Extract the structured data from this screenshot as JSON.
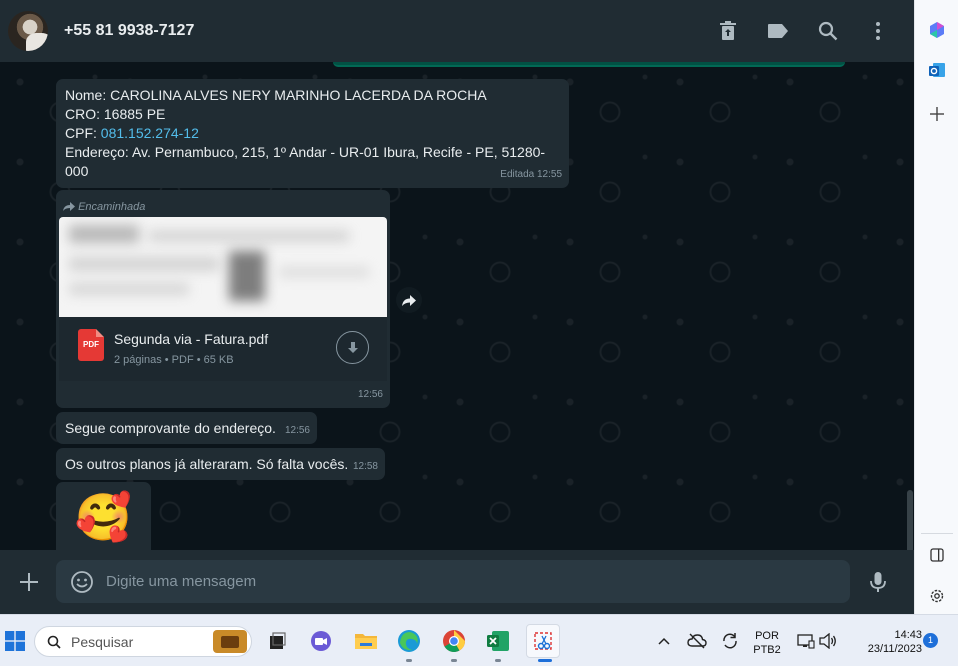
{
  "header": {
    "contact_name": "+55 81 9938-7127"
  },
  "messages": {
    "info": {
      "line1": "Nome: CAROLINA ALVES NERY MARINHO LACERDA DA ROCHA",
      "line2": "CRO: 16885 PE",
      "cpf_label": "CPF: ",
      "cpf_value": "081.152.274-12",
      "line4": "Endereço: Av. Pernambuco, 215, 1º Andar - UR-01 Ibura, Recife - PE, 51280-000",
      "time": "Editada 12:55"
    },
    "forwarded": {
      "label": "Encaminhada",
      "file_name": "Segunda via - Fatura.pdf",
      "file_meta": "2 páginas • PDF • 65 KB",
      "pdf_badge": "PDF",
      "time": "12:56"
    },
    "msg3": {
      "text": "Segue comprovante do endereço.",
      "time": "12:56"
    },
    "msg4": {
      "text": "Os outros planos já alteraram. Só falta vocês.",
      "time": "12:58"
    },
    "msg5": {
      "emoji": "🥰"
    }
  },
  "composer": {
    "placeholder": "Digite uma mensagem"
  },
  "taskbar": {
    "search_placeholder": "Pesquisar",
    "lang_line1": "POR",
    "lang_line2": "PTB2",
    "time": "14:43",
    "date": "23/11/2023",
    "notification_count": "1"
  },
  "colors": {
    "chat_bg": "#0b141a",
    "header_bg": "#202c33",
    "bubble_bg": "#202c33",
    "link": "#53bdeb",
    "accent_green": "#025144"
  },
  "icons": [
    "delete-icon",
    "label-icon",
    "search-icon",
    "menu-icon",
    "forward-icon",
    "download-icon",
    "share-icon",
    "plus-icon",
    "emoji-icon",
    "mic-icon",
    "copilot-icon",
    "outlook-icon",
    "add-icon",
    "sidebar-toggle-icon",
    "settings-icon",
    "windows-icon"
  ]
}
